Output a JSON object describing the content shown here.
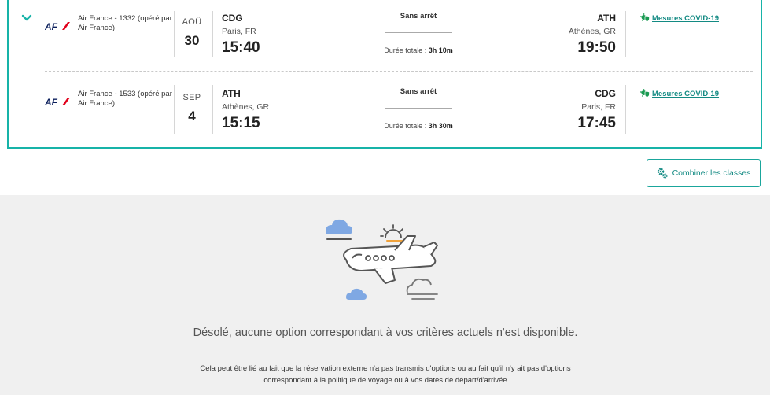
{
  "flights": [
    {
      "airline": "Air France - 1332 (opéré par Air France)",
      "month": "AOÛ",
      "day": "30",
      "dep_code": "CDG",
      "dep_city": "Paris, FR",
      "dep_time": "15:40",
      "stops": "Sans arrêt",
      "duration_label": "Durée totale :",
      "duration_value": "3h 10m",
      "arr_code": "ATH",
      "arr_city": "Athènes, GR",
      "arr_time": "19:50",
      "covid": "Mesures COVID-19"
    },
    {
      "airline": "Air France - 1533 (opéré par Air France)",
      "month": "SEP",
      "day": "4",
      "dep_code": "ATH",
      "dep_city": "Athènes, GR",
      "dep_time": "15:15",
      "stops": "Sans arrêt",
      "duration_label": "Durée totale :",
      "duration_value": "3h 30m",
      "arr_code": "CDG",
      "arr_city": "Paris, FR",
      "arr_time": "17:45",
      "covid": "Mesures COVID-19"
    }
  ],
  "combine_button": "Combiner les classes",
  "empty": {
    "message": "Désolé, aucune option correspondant à vos critères actuels n'est disponible.",
    "detail": "Cela peut être lié au fait que la réservation externe n'a pas transmis d'options ou au fait qu'il n'y ait pas d'options correspondant à la politique de voyage ou à vos dates de départ/d'arrivée"
  },
  "colors": {
    "accent": "#17b3a8",
    "link": "#138a83",
    "airfrance_blue": "#0b1f5c",
    "airfrance_red": "#e1001a"
  },
  "icons": {
    "expand": "chevron-down-icon",
    "covid": "virus-shield-icon",
    "combine": "gears-icon",
    "empty_state": "airplane-illustration"
  }
}
